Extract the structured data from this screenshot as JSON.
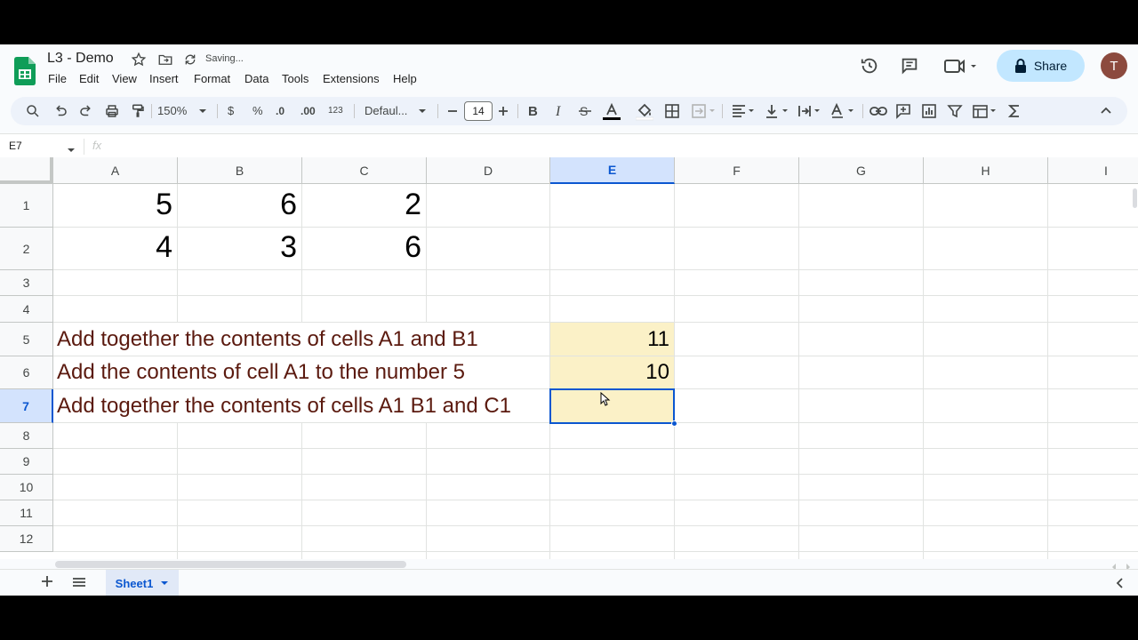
{
  "header": {
    "doc_title": "L3 - Demo",
    "saving_status": "Saving...",
    "share_label": "Share",
    "avatar_initial": "T"
  },
  "menu": {
    "items": [
      "File",
      "Edit",
      "View",
      "Insert",
      "Format",
      "Data",
      "Tools",
      "Extensions",
      "Help"
    ]
  },
  "toolbar": {
    "zoom": "150%",
    "currency": "$",
    "percent": "%",
    "decrease_decimal": ".0",
    "increase_decimal": ".00",
    "number_format": "123",
    "font_name": "Defaul...",
    "font_size": "14"
  },
  "formula_bar": {
    "name_box": "E7",
    "fx": "fx"
  },
  "grid": {
    "columns": [
      "A",
      "B",
      "C",
      "D",
      "E",
      "F",
      "G",
      "H",
      "I"
    ],
    "rows": [
      "1",
      "2",
      "3",
      "4",
      "5",
      "6",
      "7",
      "8",
      "9",
      "10",
      "11",
      "12"
    ],
    "selected_column": "E",
    "selected_row": "7",
    "cells": {
      "A1": "5",
      "B1": "6",
      "C1": "2",
      "A2": "4",
      "B2": "3",
      "C2": "6",
      "A5": "Add together the contents of cells A1 and B1",
      "A6": "Add the contents of cell A1 to the number 5",
      "A7": "Add together the contents of cells A1 B1 and C1",
      "E5": "11",
      "E6": "10",
      "E7": ""
    }
  },
  "sheets": {
    "tabs": [
      "Sheet1"
    ]
  },
  "colors": {
    "share_bg": "#c2e7ff",
    "selection": "#0b57d0",
    "highlight": "#fbf1c7",
    "text_brown": "#5b1a0f"
  }
}
